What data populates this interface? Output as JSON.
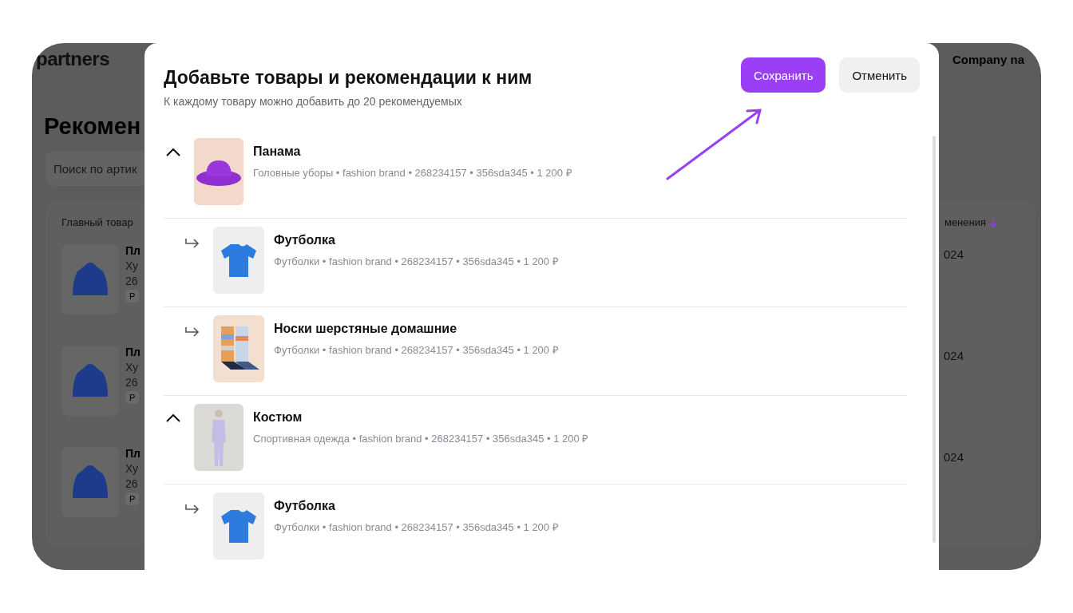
{
  "background_page": {
    "logo": "partners",
    "account": "Company na",
    "heading": "Рекомен",
    "search": {
      "placeholder": "Поиск по артик"
    },
    "table": {
      "columns": [
        "Главный товар",
        "менения"
      ],
      "rows": [
        {
          "name": "Пл",
          "category": "Ху",
          "code": "26",
          "tag": "Р",
          "date": "024"
        },
        {
          "name": "Пл",
          "category": "Ху",
          "code": "26",
          "tag": "Р",
          "date": "024"
        },
        {
          "name": "Пл",
          "category": "Ху",
          "code": "26",
          "tag": "Р",
          "date": "024"
        }
      ]
    }
  },
  "dialog": {
    "title": "Добавьте товары и рекомендации к ним",
    "subtitle": "К каждому товару можно добавить до 20 рекомендуемых",
    "buttons": [
      {
        "label": "Сохранить",
        "kind": "primary"
      },
      {
        "label": "Отменить",
        "kind": "secondary"
      }
    ],
    "products": [
      {
        "name": "Панама",
        "meta": "Головные уборы • fashion brand • 268234157 • 356sda345 • 1 200 ₽",
        "kind": "hat",
        "expanded": true,
        "children": [
          {
            "name": "Футболка",
            "meta": "Футболки • fashion brand • 268234157 • 356sda345 • 1 200 ₽",
            "kind": "tshirt"
          },
          {
            "name": "Носки шерстяные домашние",
            "meta": "Футболки • fashion brand • 268234157 • 356sda345 • 1 200 ₽",
            "kind": "socks"
          }
        ]
      },
      {
        "name": "Костюм",
        "meta": "Спортивная одежда • fashion brand • 268234157 • 356sda345 • 1 200 ₽",
        "kind": "suit",
        "expanded": true,
        "children": [
          {
            "name": "Футболка",
            "meta": "Футболки • fashion brand • 268234157 • 356sda345 • 1 200 ₽",
            "kind": "tshirt"
          }
        ]
      }
    ]
  }
}
